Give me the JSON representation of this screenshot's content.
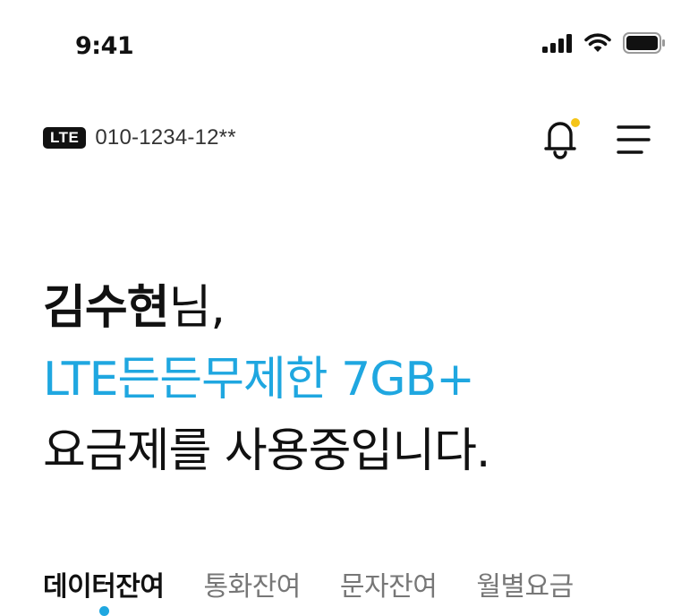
{
  "status_bar": {
    "time": "9:41",
    "icons": [
      "signal-icon",
      "wifi-icon",
      "battery-icon"
    ]
  },
  "header": {
    "network_badge": "LTE",
    "phone_number": "010-1234-12**",
    "icons": [
      "bell-icon",
      "menu-icon"
    ]
  },
  "greeting": {
    "name": "김수현",
    "name_suffix": "님,",
    "plan_name": "LTE든든무제한 7GB+",
    "sentence": "요금제를 사용중입니다."
  },
  "tabs": [
    {
      "label": "데이터잔여",
      "active": true
    },
    {
      "label": "통화잔여",
      "active": false
    },
    {
      "label": "문자잔여",
      "active": false
    },
    {
      "label": "월별요금",
      "active": false
    }
  ],
  "colors": {
    "accent": "#1fa7e0",
    "notification_dot": "#f5c518",
    "text": "#111111",
    "muted": "#777777"
  }
}
